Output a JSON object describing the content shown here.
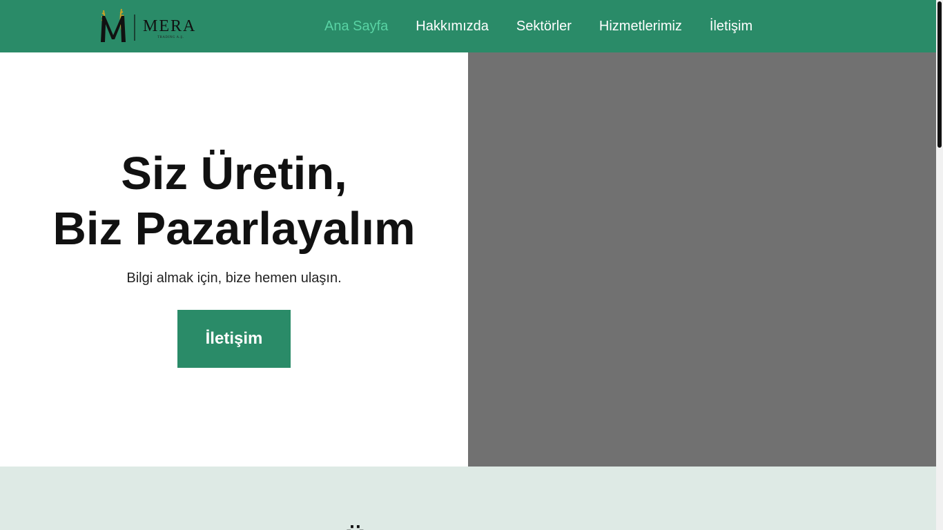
{
  "colors": {
    "navbar": "#2a8b68",
    "nav_active": "#59d3a4",
    "button": "#2a8b68",
    "hero_image_placeholder": "#717171",
    "section_bg": "#deeae5"
  },
  "brand": {
    "name": "MERA",
    "subtitle": "TRADING A.Ş.",
    "logo_icon": "wheat-m-logo-icon"
  },
  "nav": {
    "items": [
      {
        "label": "Ana Sayfa",
        "active": true
      },
      {
        "label": "Hakkımızda",
        "active": false
      },
      {
        "label": "Sektörler",
        "active": false
      },
      {
        "label": "Hizmetlerimiz",
        "active": false
      },
      {
        "label": "İletişim",
        "active": false
      }
    ]
  },
  "hero": {
    "title_line1": "Siz Üretin,",
    "title_line2": "Biz Pazarlayalım",
    "subtitle": "Bilgi almak için, bize hemen ulaşın.",
    "button_label": "İletişim"
  }
}
